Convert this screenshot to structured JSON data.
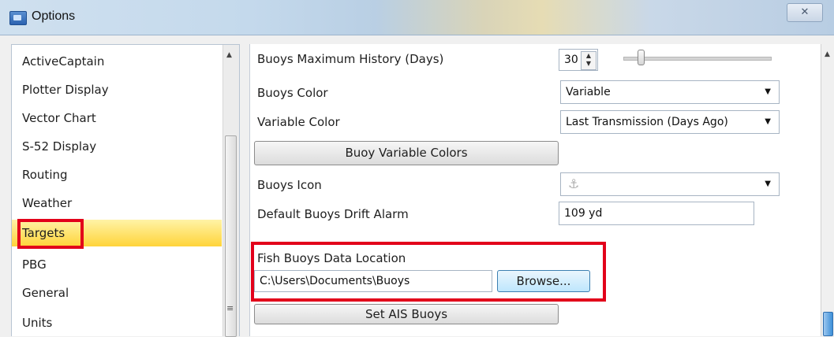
{
  "window": {
    "title": "Options",
    "close_glyph": "✕",
    "app_icon": "options-window-icon"
  },
  "sidebar": {
    "items": [
      {
        "label": "ActiveCaptain"
      },
      {
        "label": "Plotter Display"
      },
      {
        "label": "Vector Chart"
      },
      {
        "label": "S-52 Display"
      },
      {
        "label": "Routing"
      },
      {
        "label": "Weather"
      },
      {
        "label": "Targets",
        "selected": true
      },
      {
        "label": "PBG"
      },
      {
        "label": "General"
      },
      {
        "label": "Units"
      }
    ],
    "selected_color": "#ffd43a"
  },
  "settings": {
    "max_history": {
      "label": "Buoys Maximum History (Days)",
      "value": "30",
      "slider_fraction": 0.1
    },
    "buoys_color": {
      "label": "Buoys Color",
      "value": "Variable"
    },
    "variable_color": {
      "label": "Variable Color",
      "value": "Last Transmission (Days Ago)"
    },
    "variable_colors_button": "Buoy Variable Colors",
    "buoys_icon": {
      "label": "Buoys Icon",
      "icon": "buoy-anchor-icon"
    },
    "drift_alarm": {
      "label": "Default Buoys Drift Alarm",
      "value": "109 yd"
    },
    "fish_location": {
      "label": "Fish Buoys Data Location",
      "value": "C:\\Users\\Documents\\Buoys",
      "browse": "Browse..."
    },
    "set_ais_button": "Set AIS Buoys"
  },
  "colors": {
    "highlight": "#e2001a",
    "accent": "#3d8fd8"
  }
}
